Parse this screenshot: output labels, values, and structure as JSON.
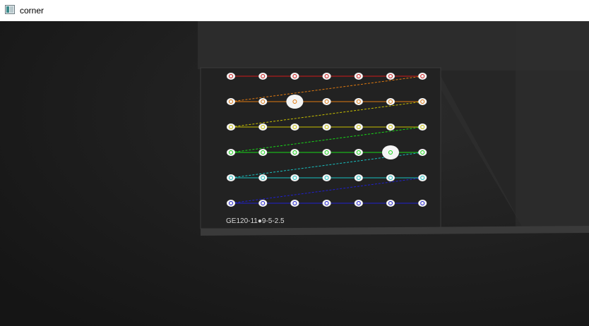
{
  "window": {
    "title": "corner",
    "icon": "opencv-window-icon"
  },
  "image": {
    "board_label": "GE120-11●9-5-2.5",
    "grid_rows": 6,
    "grid_cols": 7,
    "row_colors": [
      "#d01a1a",
      "#e07a10",
      "#c8c000",
      "#18d818",
      "#18c0c0",
      "#2020d0"
    ],
    "large_markers": [
      {
        "row": 1,
        "col": 2
      },
      {
        "row": 3,
        "col": 5
      }
    ]
  }
}
